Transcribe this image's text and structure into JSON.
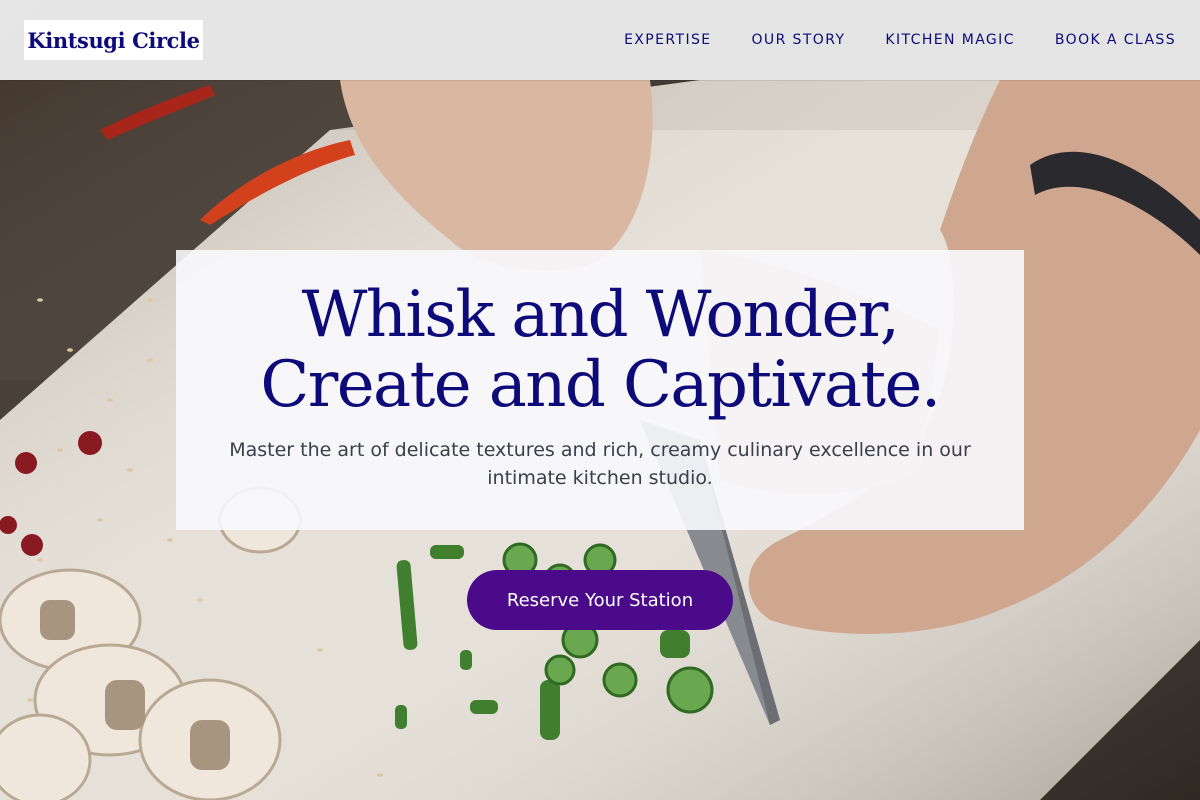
{
  "brand": {
    "name": "Kintsugi Circle"
  },
  "nav": {
    "items": [
      {
        "label": "EXPERTISE"
      },
      {
        "label": "OUR STORY"
      },
      {
        "label": "KITCHEN MAGIC"
      },
      {
        "label": "BOOK A CLASS"
      }
    ]
  },
  "hero": {
    "title": "Whisk and Wonder, Create and Captivate.",
    "subtitle": "Master the art of delicate textures and rich, creamy culinary excellence in our intimate kitchen studio.",
    "cta_label": "Reserve Your Station"
  },
  "colors": {
    "brand_text": "#0d0a7a",
    "cta_background": "#4a0a8a",
    "header_background": "#f5f5f6"
  }
}
